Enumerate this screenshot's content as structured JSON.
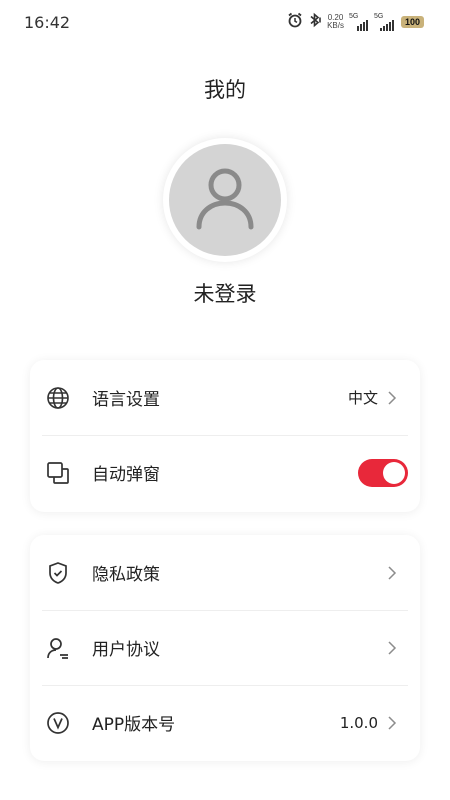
{
  "status_bar": {
    "time": "16:42",
    "net_speed": "0.20",
    "net_unit": "KB/s",
    "signal_1": "5G",
    "signal_2": "5G",
    "battery": "100",
    "icons": [
      "alarm-icon",
      "bluetooth-icon"
    ]
  },
  "header": {
    "title": "我的"
  },
  "profile": {
    "status": "未登录",
    "avatar_icon": "user-icon"
  },
  "settings": {
    "language": {
      "label": "语言设置",
      "value": "中文",
      "icon": "globe-icon"
    },
    "auto_popup": {
      "label": "自动弹窗",
      "enabled": true,
      "icon": "window-icon"
    }
  },
  "about": {
    "privacy": {
      "label": "隐私政策",
      "icon": "shield-icon"
    },
    "agreement": {
      "label": "用户协议",
      "icon": "user-doc-icon"
    },
    "version": {
      "label": "APP版本号",
      "value": "1.0.0",
      "icon": "version-icon"
    }
  },
  "colors": {
    "accent": "#e8283a",
    "avatar_bg": "#d4d4d4",
    "battery": "#c9b27a"
  }
}
